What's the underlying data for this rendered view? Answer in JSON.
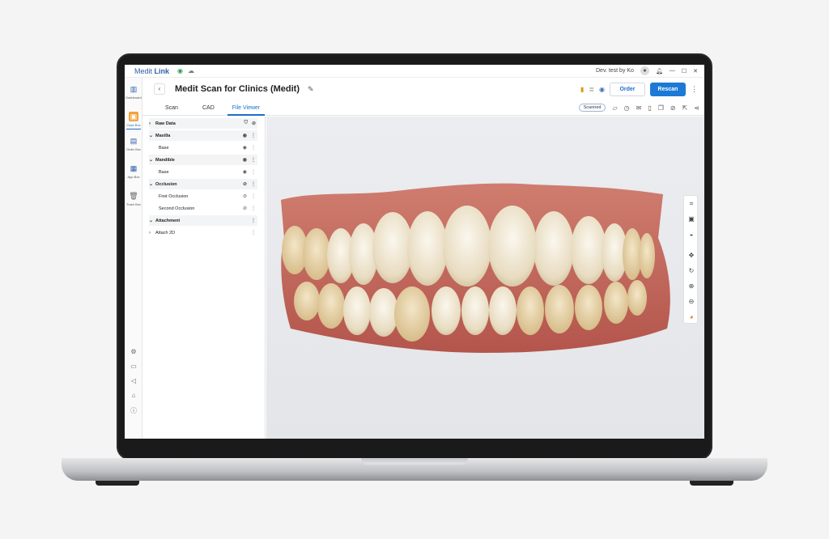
{
  "app": {
    "brand_prefix": "Medit",
    "brand_suffix": "Link",
    "user_label": "Dev. test by Ko"
  },
  "rail": {
    "items": [
      {
        "label": "Dashboard",
        "icon": "chart-icon"
      },
      {
        "label": "Case Box",
        "icon": "case-box-icon"
      },
      {
        "label": "Order Box",
        "icon": "order-box-icon"
      },
      {
        "label": "App Box",
        "icon": "app-box-icon"
      },
      {
        "label": "Trash Box",
        "icon": "trash-icon"
      }
    ],
    "bottom_icons": [
      "settings-icon",
      "folder-icon",
      "megaphone-icon",
      "home-icon",
      "info-icon"
    ]
  },
  "header": {
    "back_glyph": "‹",
    "title": "Medit Scan for Clinics (Medit)",
    "order_label": "Order",
    "rescan_label": "Rescan"
  },
  "tabs": [
    {
      "label": "Scan"
    },
    {
      "label": "CAD"
    },
    {
      "label": "File Viewer",
      "active": true
    }
  ],
  "status_chip": "Scanned",
  "tree": [
    {
      "label": "Raw Data",
      "type": "group",
      "expanded": false
    },
    {
      "label": "Maxilla",
      "type": "group",
      "expanded": true
    },
    {
      "label": "Base",
      "type": "item"
    },
    {
      "label": "Mandible",
      "type": "group",
      "expanded": true
    },
    {
      "label": "Base",
      "type": "item"
    },
    {
      "label": "Occlusion",
      "type": "group",
      "expanded": true
    },
    {
      "label": "First Occlusion",
      "type": "item"
    },
    {
      "label": "Second Occlusion",
      "type": "item"
    },
    {
      "label": "Attachment",
      "type": "group",
      "expanded": true
    },
    {
      "label": "Attach 2D",
      "type": "item-collapsed"
    }
  ],
  "colors": {
    "accent": "#1c7ad6",
    "active_case_box": "#f1a23a",
    "gum": "#c96a5f",
    "tooth": "#ede4cf"
  }
}
